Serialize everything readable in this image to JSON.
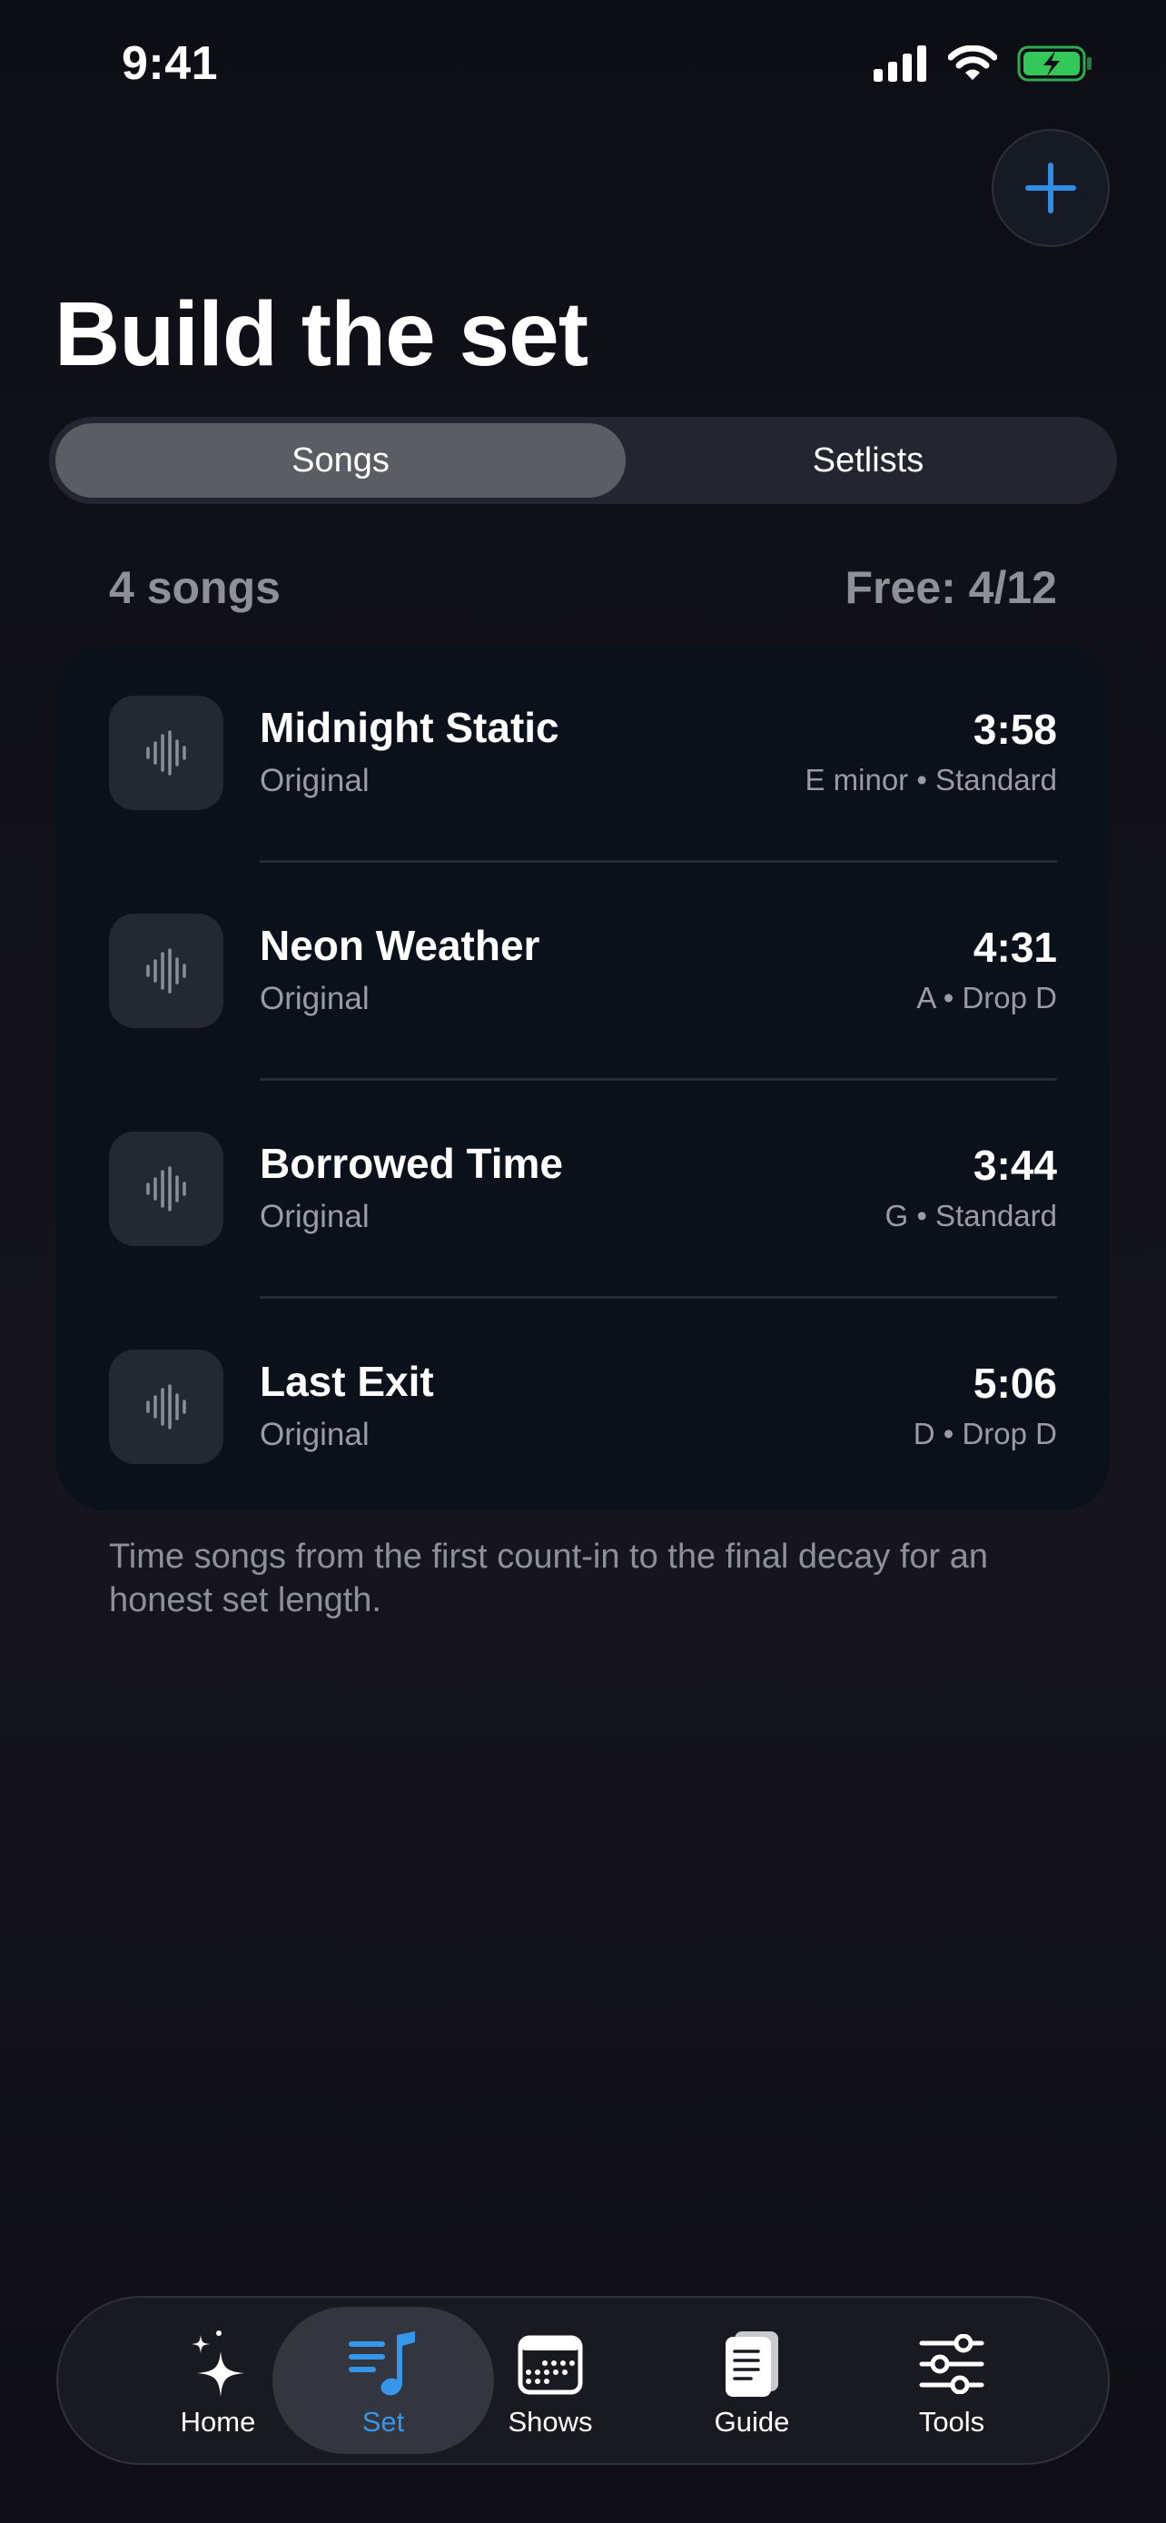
{
  "status_bar": {
    "time": "9:41",
    "signal_icon": "cellular-signal-icon",
    "wifi_icon": "wifi-icon",
    "battery_icon": "battery-charging-icon",
    "battery_color": "#34c759"
  },
  "header": {
    "add_icon": "plus-icon",
    "title": "Build the set"
  },
  "segmented": {
    "songs_label": "Songs",
    "setlists_label": "Setlists",
    "selected": "Songs"
  },
  "list": {
    "count_label": "4 songs",
    "quota_label": "Free: 4/12",
    "songs": [
      {
        "title": "Midnight Static",
        "type": "Original",
        "duration": "3:58",
        "meta": "E minor • Standard",
        "icon": "waveform-icon"
      },
      {
        "title": "Neon Weather",
        "type": "Original",
        "duration": "4:31",
        "meta": "A • Drop D",
        "icon": "waveform-icon"
      },
      {
        "title": "Borrowed Time",
        "type": "Original",
        "duration": "3:44",
        "meta": "G • Standard",
        "icon": "waveform-icon"
      },
      {
        "title": "Last Exit",
        "type": "Original",
        "duration": "5:06",
        "meta": "D • Drop D",
        "icon": "waveform-icon"
      }
    ],
    "footnote": "Time songs from the first count-in to the final decay for an honest set length."
  },
  "tab_bar": {
    "tabs": [
      {
        "label": "Home",
        "icon": "sparkles-icon"
      },
      {
        "label": "Set",
        "icon": "music-list-icon"
      },
      {
        "label": "Shows",
        "icon": "calendar-icon"
      },
      {
        "label": "Guide",
        "icon": "book-icon"
      },
      {
        "label": "Tools",
        "icon": "sliders-icon"
      }
    ],
    "active": "Set",
    "accent_color": "#3596ea"
  }
}
